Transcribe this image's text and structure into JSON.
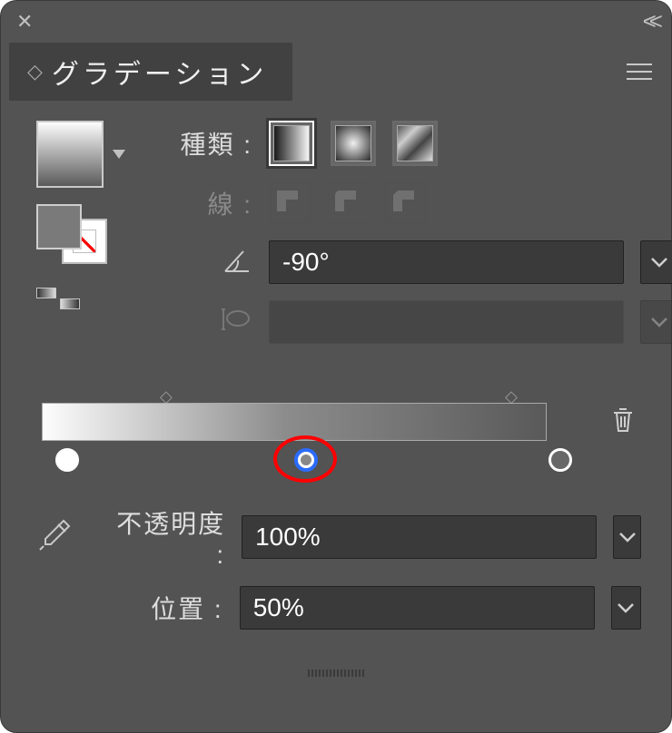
{
  "panel_title": "グラデーション",
  "labels": {
    "type": "種類 :",
    "stroke": "線 :",
    "opacity": "不透明度 :",
    "location": "位置 :"
  },
  "values": {
    "angle": "-90°",
    "aspect": "",
    "opacity": "100%",
    "location": "50%"
  },
  "icons": {
    "close": "close-icon",
    "collapse": "collapse-icon",
    "menu": "menu-icon"
  }
}
